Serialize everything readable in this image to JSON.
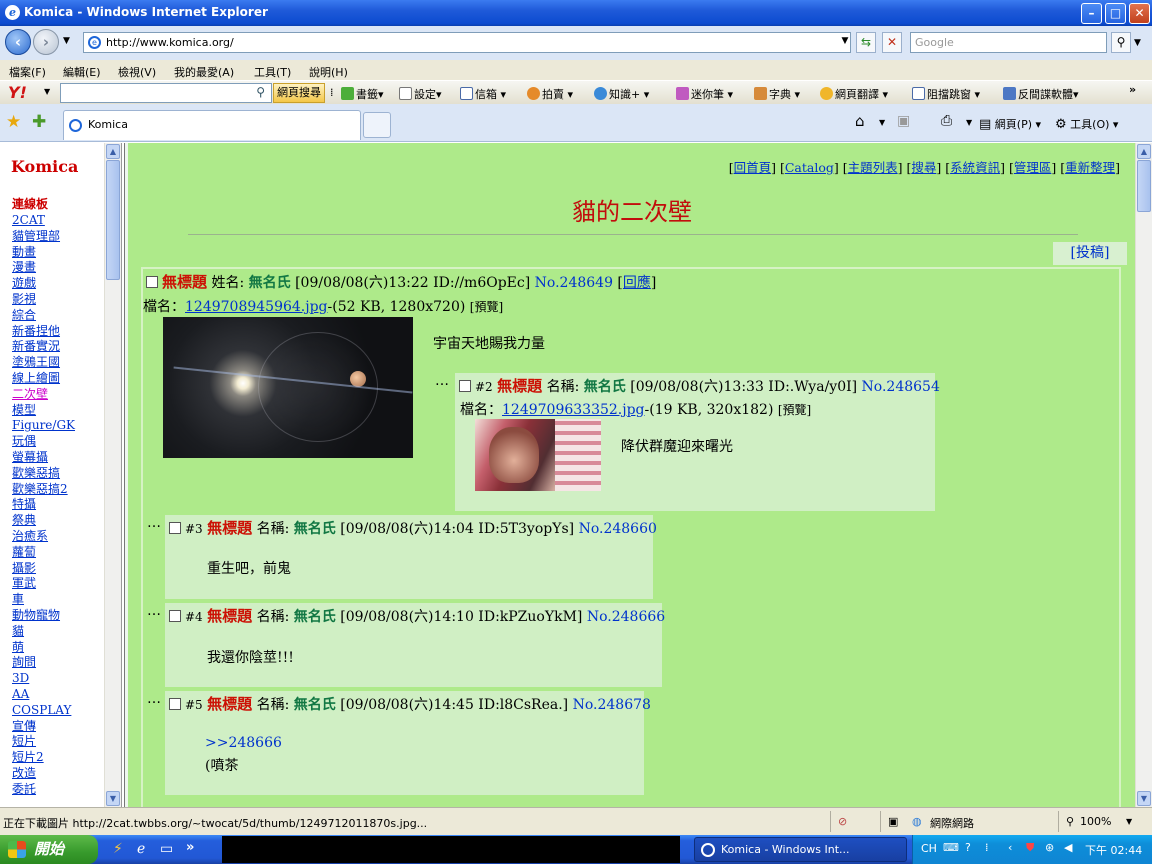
{
  "window": {
    "title": "Komica - Windows Internet Explorer",
    "min": "–",
    "max": "□",
    "close": "✕"
  },
  "address": {
    "url": "http://www.komica.org/",
    "search_placeholder": "Google"
  },
  "menu": [
    "檔案(F)",
    "編輯(E)",
    "檢視(V)",
    "我的最愛(A)",
    "工具(T)",
    "說明(H)"
  ],
  "yahoo_toolbar": {
    "logo": "Y!",
    "search_button": "網頁搜尋",
    "items": [
      "書籤",
      "設定",
      "信箱",
      "拍賣",
      "知識+",
      "迷你筆",
      "字典",
      "網頁翻譯",
      "阻擋跳窗",
      "反間諜軟體"
    ]
  },
  "tab": {
    "label": "Komica",
    "commands": [
      "網頁(P)",
      "工具(O)"
    ]
  },
  "sidebar": {
    "brand": "Komica",
    "heading": "連線板",
    "boards": [
      "2CAT",
      "貓管理部",
      "動畫",
      "漫畫",
      "遊戲",
      "影視",
      "綜合",
      "新番捏他",
      "新番實況",
      "塗鴉王國",
      "線上繪圖",
      "二次壁",
      "模型",
      "Figure/GK",
      "玩偶",
      "螢幕攝",
      "歡樂惡搞",
      "歡樂惡搞2",
      "特攝",
      "祭典",
      "治癒系",
      "蘿蔔",
      "攝影",
      "軍武",
      "車",
      "動物寵物",
      "貓",
      "萌",
      "詢問",
      "3D",
      "AA",
      "COSPLAY",
      "宣傳",
      "短片",
      "短片2",
      "改造",
      "委託"
    ],
    "current_board": "二次壁"
  },
  "board": {
    "top_links": [
      "回首頁",
      "Catalog",
      "主題列表",
      "搜尋",
      "系統資訊",
      "管理區",
      "重新整理"
    ],
    "title": "貓的二次壁",
    "post_button": "[投稿]"
  },
  "op": {
    "subject": "無標題",
    "name_label": "姓名:",
    "name": "無名氏",
    "datetime": "[09/08/08(六)13:22 ID://m6OpEc]",
    "no": "No.248649",
    "reply_link": "回應",
    "file_label": "檔名：",
    "file_name": "1249708945964.jpg",
    "file_info": "-(52 KB, 1280x720)",
    "preview": "[預覽]",
    "body": "宇宙天地賜我力量"
  },
  "replies": [
    {
      "num": "#2",
      "subject": "無標題",
      "name_label": "名稱:",
      "name": "無名氏",
      "datetime": "[09/08/08(六)13:33 ID:.Wya/y0I]",
      "no": "No.248654",
      "file_label": "檔名：",
      "file_name": "1249709633352.jpg",
      "file_info": "-(19 KB, 320x182)",
      "preview": "[預覽]",
      "body": "降伏群魔迎來曙光"
    },
    {
      "num": "#3",
      "subject": "無標題",
      "name_label": "名稱:",
      "name": "無名氏",
      "datetime": "[09/08/08(六)14:04 ID:5T3yopYs]",
      "no": "No.248660",
      "body": "重生吧，前鬼"
    },
    {
      "num": "#4",
      "subject": "無標題",
      "name_label": "名稱:",
      "name": "無名氏",
      "datetime": "[09/08/08(六)14:10 ID:kPZuoYkM]",
      "no": "No.248666",
      "body": "我還你陰莖!!!"
    },
    {
      "num": "#5",
      "subject": "無標題",
      "name_label": "名稱:",
      "name": "無名氏",
      "datetime": "[09/08/08(六)14:45 ID:l8CsRea.]",
      "no": "No.248678",
      "quote": ">>248666",
      "body": "(噴茶"
    }
  ],
  "status": {
    "text": "正在下載圖片 http://2cat.twbbs.org/~twocat/5d/thumb/1249712011870s.jpg...",
    "zone": "網際網路",
    "zoom": "100%"
  },
  "taskbar": {
    "start": "開始",
    "task": "Komica - Windows Int...",
    "lang": "CH",
    "clock": "下午 02:44"
  },
  "colors": {
    "board_bg": "#aeea8a",
    "reply_bg": "#d0efc4",
    "subject": "#cc1105",
    "name": "#117743",
    "link": "#0033cc"
  }
}
